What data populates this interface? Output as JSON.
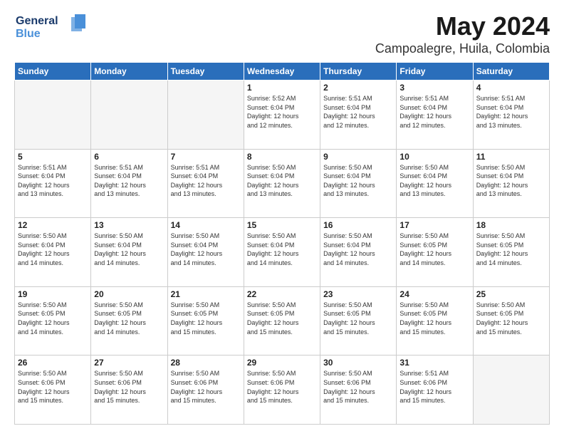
{
  "logo": {
    "line1": "General",
    "line2": "Blue"
  },
  "title": "May 2024",
  "location": "Campoalegre, Huila, Colombia",
  "days_header": [
    "Sunday",
    "Monday",
    "Tuesday",
    "Wednesday",
    "Thursday",
    "Friday",
    "Saturday"
  ],
  "weeks": [
    [
      {
        "day": "",
        "text": ""
      },
      {
        "day": "",
        "text": ""
      },
      {
        "day": "",
        "text": ""
      },
      {
        "day": "1",
        "text": "Sunrise: 5:52 AM\nSunset: 6:04 PM\nDaylight: 12 hours\nand 12 minutes."
      },
      {
        "day": "2",
        "text": "Sunrise: 5:51 AM\nSunset: 6:04 PM\nDaylight: 12 hours\nand 12 minutes."
      },
      {
        "day": "3",
        "text": "Sunrise: 5:51 AM\nSunset: 6:04 PM\nDaylight: 12 hours\nand 12 minutes."
      },
      {
        "day": "4",
        "text": "Sunrise: 5:51 AM\nSunset: 6:04 PM\nDaylight: 12 hours\nand 13 minutes."
      }
    ],
    [
      {
        "day": "5",
        "text": "Sunrise: 5:51 AM\nSunset: 6:04 PM\nDaylight: 12 hours\nand 13 minutes."
      },
      {
        "day": "6",
        "text": "Sunrise: 5:51 AM\nSunset: 6:04 PM\nDaylight: 12 hours\nand 13 minutes."
      },
      {
        "day": "7",
        "text": "Sunrise: 5:51 AM\nSunset: 6:04 PM\nDaylight: 12 hours\nand 13 minutes."
      },
      {
        "day": "8",
        "text": "Sunrise: 5:50 AM\nSunset: 6:04 PM\nDaylight: 12 hours\nand 13 minutes."
      },
      {
        "day": "9",
        "text": "Sunrise: 5:50 AM\nSunset: 6:04 PM\nDaylight: 12 hours\nand 13 minutes."
      },
      {
        "day": "10",
        "text": "Sunrise: 5:50 AM\nSunset: 6:04 PM\nDaylight: 12 hours\nand 13 minutes."
      },
      {
        "day": "11",
        "text": "Sunrise: 5:50 AM\nSunset: 6:04 PM\nDaylight: 12 hours\nand 13 minutes."
      }
    ],
    [
      {
        "day": "12",
        "text": "Sunrise: 5:50 AM\nSunset: 6:04 PM\nDaylight: 12 hours\nand 14 minutes."
      },
      {
        "day": "13",
        "text": "Sunrise: 5:50 AM\nSunset: 6:04 PM\nDaylight: 12 hours\nand 14 minutes."
      },
      {
        "day": "14",
        "text": "Sunrise: 5:50 AM\nSunset: 6:04 PM\nDaylight: 12 hours\nand 14 minutes."
      },
      {
        "day": "15",
        "text": "Sunrise: 5:50 AM\nSunset: 6:04 PM\nDaylight: 12 hours\nand 14 minutes."
      },
      {
        "day": "16",
        "text": "Sunrise: 5:50 AM\nSunset: 6:04 PM\nDaylight: 12 hours\nand 14 minutes."
      },
      {
        "day": "17",
        "text": "Sunrise: 5:50 AM\nSunset: 6:05 PM\nDaylight: 12 hours\nand 14 minutes."
      },
      {
        "day": "18",
        "text": "Sunrise: 5:50 AM\nSunset: 6:05 PM\nDaylight: 12 hours\nand 14 minutes."
      }
    ],
    [
      {
        "day": "19",
        "text": "Sunrise: 5:50 AM\nSunset: 6:05 PM\nDaylight: 12 hours\nand 14 minutes."
      },
      {
        "day": "20",
        "text": "Sunrise: 5:50 AM\nSunset: 6:05 PM\nDaylight: 12 hours\nand 14 minutes."
      },
      {
        "day": "21",
        "text": "Sunrise: 5:50 AM\nSunset: 6:05 PM\nDaylight: 12 hours\nand 15 minutes."
      },
      {
        "day": "22",
        "text": "Sunrise: 5:50 AM\nSunset: 6:05 PM\nDaylight: 12 hours\nand 15 minutes."
      },
      {
        "day": "23",
        "text": "Sunrise: 5:50 AM\nSunset: 6:05 PM\nDaylight: 12 hours\nand 15 minutes."
      },
      {
        "day": "24",
        "text": "Sunrise: 5:50 AM\nSunset: 6:05 PM\nDaylight: 12 hours\nand 15 minutes."
      },
      {
        "day": "25",
        "text": "Sunrise: 5:50 AM\nSunset: 6:05 PM\nDaylight: 12 hours\nand 15 minutes."
      }
    ],
    [
      {
        "day": "26",
        "text": "Sunrise: 5:50 AM\nSunset: 6:06 PM\nDaylight: 12 hours\nand 15 minutes."
      },
      {
        "day": "27",
        "text": "Sunrise: 5:50 AM\nSunset: 6:06 PM\nDaylight: 12 hours\nand 15 minutes."
      },
      {
        "day": "28",
        "text": "Sunrise: 5:50 AM\nSunset: 6:06 PM\nDaylight: 12 hours\nand 15 minutes."
      },
      {
        "day": "29",
        "text": "Sunrise: 5:50 AM\nSunset: 6:06 PM\nDaylight: 12 hours\nand 15 minutes."
      },
      {
        "day": "30",
        "text": "Sunrise: 5:50 AM\nSunset: 6:06 PM\nDaylight: 12 hours\nand 15 minutes."
      },
      {
        "day": "31",
        "text": "Sunrise: 5:51 AM\nSunset: 6:06 PM\nDaylight: 12 hours\nand 15 minutes."
      },
      {
        "day": "",
        "text": ""
      }
    ]
  ]
}
